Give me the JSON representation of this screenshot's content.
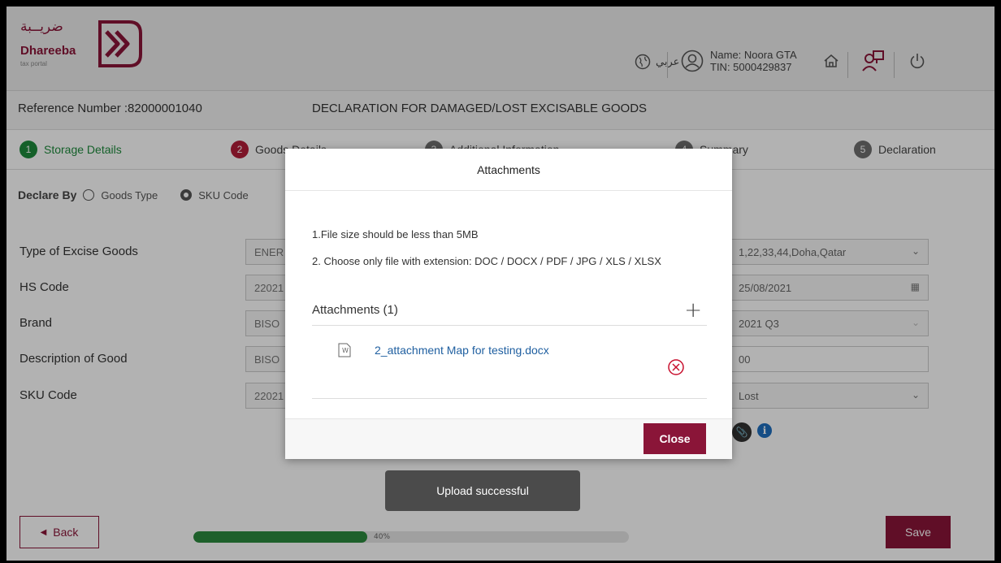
{
  "header": {
    "logo_ar": "ضريــبة",
    "logo_en": "Dhareeba",
    "logo_sub": "tax portal",
    "lang_label": "عربي",
    "user_name": "Name: Noora GTA",
    "user_tin": "TIN: 5000429837"
  },
  "subheader": {
    "reference": "Reference Number :82000001040",
    "title": "DECLARATION FOR DAMAGED/LOST EXCISABLE GOODS"
  },
  "steps": [
    {
      "num": "1",
      "label": "Storage Details"
    },
    {
      "num": "2",
      "label": "Goods Details"
    },
    {
      "num": "3",
      "label": "Additional Information"
    },
    {
      "num": "4",
      "label": "Summary"
    },
    {
      "num": "5",
      "label": "Declaration"
    }
  ],
  "declare_by": {
    "label": "Declare By",
    "option1": "Goods Type",
    "option2": "SKU Code"
  },
  "form": {
    "labels": [
      "Type of Excise Goods",
      "HS Code",
      "Brand",
      "Description of Good",
      "SKU Code"
    ],
    "left_values": [
      "ENER",
      "22021",
      "BISO",
      "BISO",
      "22021"
    ],
    "right_values": [
      "1,22,33,44,Doha,Qatar",
      "25/08/2021",
      "2021 Q3",
      "00",
      "Lost"
    ]
  },
  "modal": {
    "title": "Attachments",
    "note1": "1.File size should be less than 5MB",
    "note2": "2. Choose only file with extension: DOC / DOCX / PDF / JPG / XLS / XLSX",
    "list_title": "Attachments (1)",
    "file_name": "2_attachment Map for testing.docx",
    "close_label": "Close"
  },
  "toast": "Upload successful",
  "footer": {
    "back_label": "Back",
    "progress": 40,
    "progress_label": "40%",
    "save_label": "Save"
  },
  "colors": {
    "brand": "#8a1538",
    "green": "#2b8a3e",
    "link": "#1f5fa0"
  }
}
